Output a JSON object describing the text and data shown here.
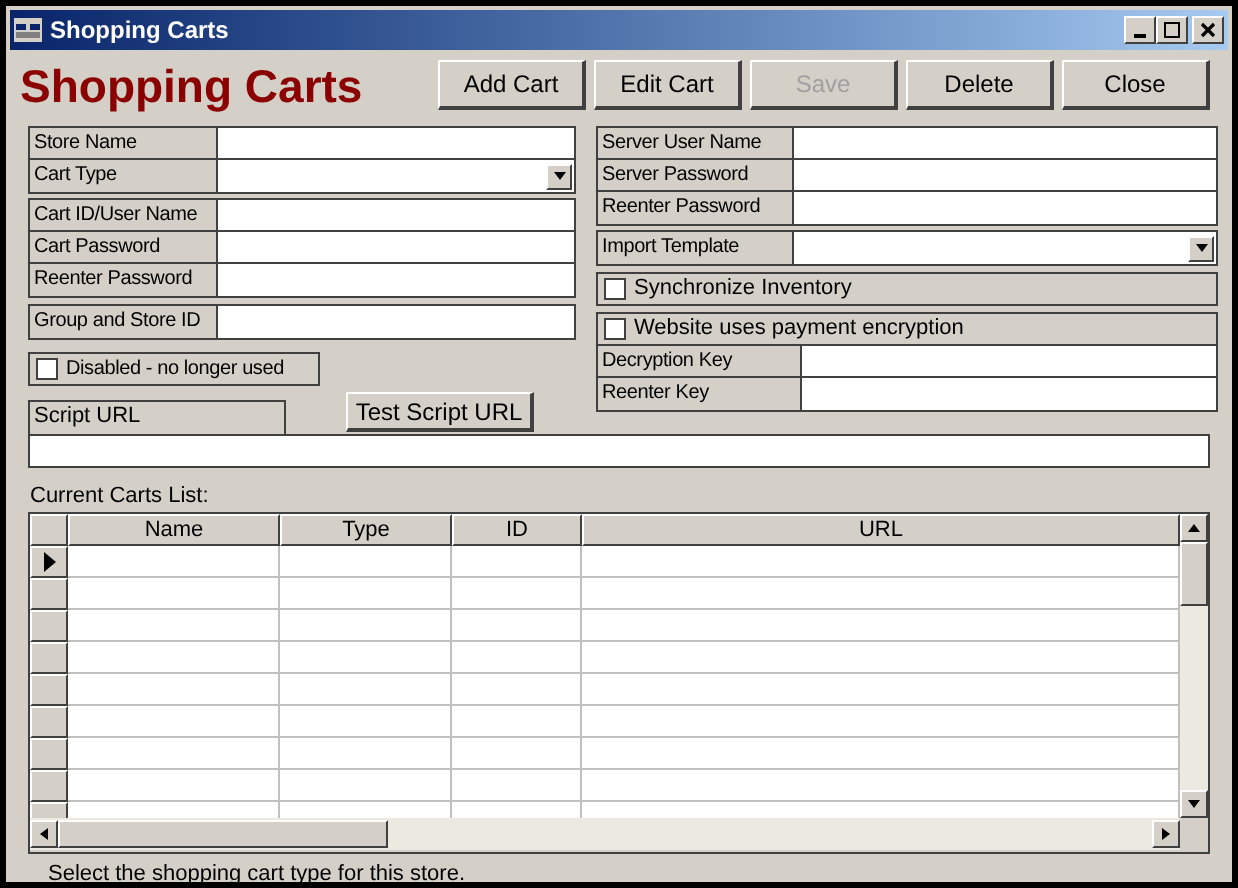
{
  "window": {
    "title": "Shopping Carts"
  },
  "heading": "Shopping Carts",
  "buttons": [
    {
      "label": "Add Cart",
      "disabled": false
    },
    {
      "label": "Edit Cart",
      "disabled": false
    },
    {
      "label": "Save",
      "disabled": true
    },
    {
      "label": "Delete",
      "disabled": false
    },
    {
      "label": "Close",
      "disabled": false
    }
  ],
  "left_groups": [
    [
      {
        "label": "Store Name",
        "kind": "text"
      },
      {
        "label": "Cart Type",
        "kind": "dropdown"
      }
    ],
    [
      {
        "label": "Cart ID/User Name",
        "kind": "text"
      },
      {
        "label": "Cart Password",
        "kind": "text"
      },
      {
        "label": "Reenter Password",
        "kind": "text"
      }
    ],
    [
      {
        "label": "Group and Store ID",
        "kind": "text"
      }
    ]
  ],
  "disabled_checkbox": {
    "label": "Disabled - no longer used",
    "checked": false
  },
  "script_url": {
    "label": "Script URL"
  },
  "test_button": {
    "label": "Test Script URL"
  },
  "right_groups": [
    [
      {
        "label": "Server User Name",
        "kind": "text"
      },
      {
        "label": "Server Password",
        "kind": "text"
      },
      {
        "label": "Reenter Password",
        "kind": "text"
      }
    ],
    [
      {
        "label": "Import Template",
        "kind": "dropdown"
      }
    ]
  ],
  "sync_checkbox": {
    "label": "Synchronize Inventory",
    "checked": false
  },
  "encryption": {
    "label": "Website uses payment encryption",
    "checked": false,
    "fields": [
      {
        "label": "Decryption Key",
        "kind": "text"
      },
      {
        "label": "Reenter Key",
        "kind": "text"
      }
    ]
  },
  "list_label": "Current Carts List:",
  "table": {
    "columns": [
      "Name",
      "Type",
      "ID",
      "URL"
    ],
    "rows": [
      {
        "selected": true
      },
      {
        "selected": false
      },
      {
        "selected": false
      },
      {
        "selected": false
      },
      {
        "selected": false
      },
      {
        "selected": false
      },
      {
        "selected": false
      },
      {
        "selected": false
      },
      {
        "selected": false
      }
    ]
  },
  "status_bar": "Select the shopping cart type for this store."
}
